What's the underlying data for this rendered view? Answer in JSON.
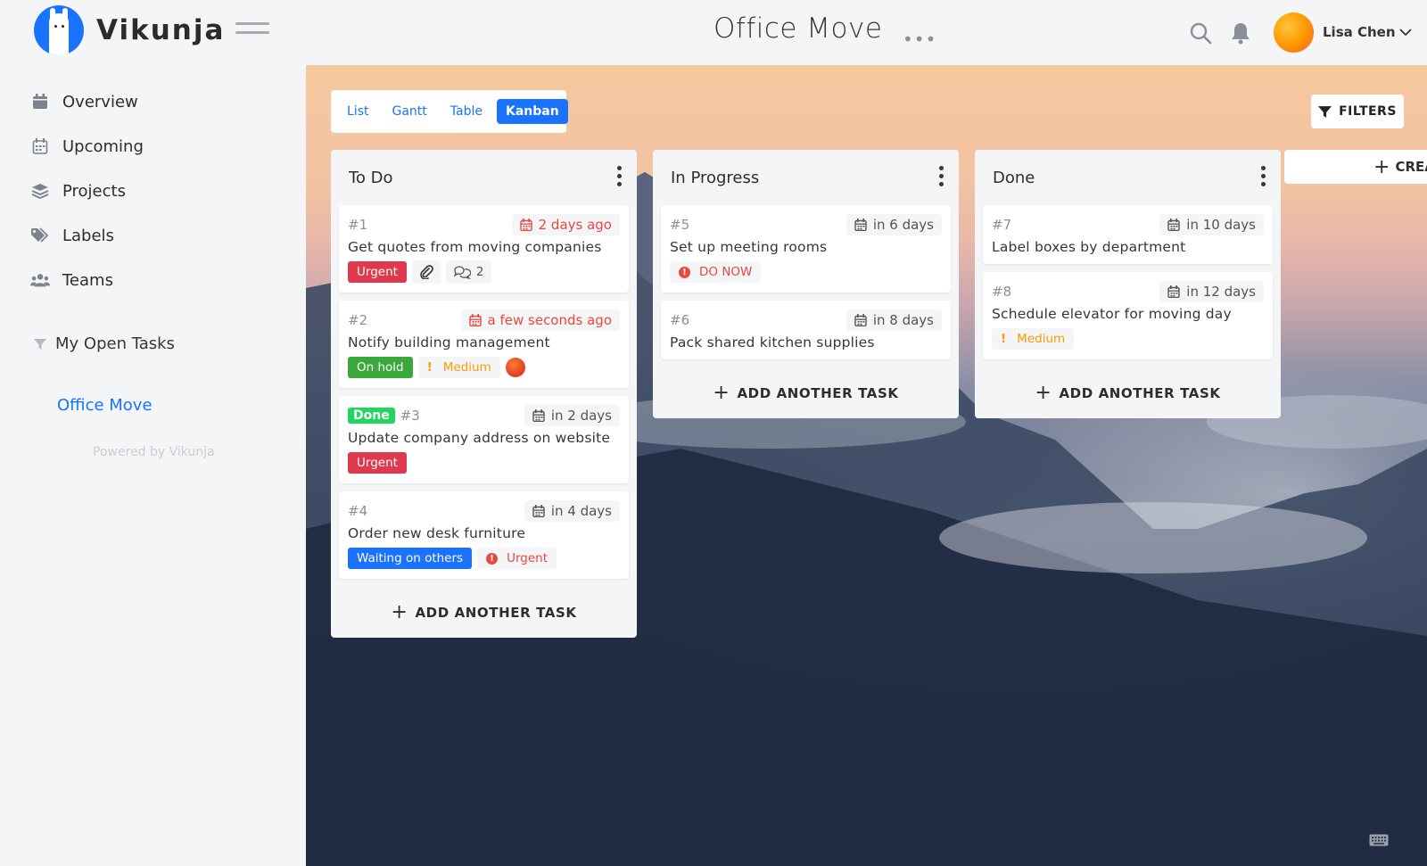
{
  "app": {
    "name": "Vikunja"
  },
  "header": {
    "board_title": "Office Move",
    "more_dots": "•••",
    "user_name": "Lisa Chen"
  },
  "sidebar": {
    "items": [
      {
        "label": "Overview",
        "icon": "calendar-icon"
      },
      {
        "label": "Upcoming",
        "icon": "calendar-grid-icon"
      },
      {
        "label": "Projects",
        "icon": "layers-icon"
      },
      {
        "label": "Labels",
        "icon": "tags-icon"
      },
      {
        "label": "Teams",
        "icon": "users-icon"
      }
    ],
    "saved_filter": "My Open Tasks",
    "project": "Office Move",
    "powered_by": "Powered by Vikunja"
  },
  "views": {
    "tabs": [
      "List",
      "Gantt",
      "Table",
      "Kanban"
    ],
    "active": "Kanban"
  },
  "filters_label": "FILTERS",
  "new_bucket_label": "CREATE A NEW BUCKET",
  "add_task_label": "ADD ANOTHER TASK",
  "colors": {
    "primary": "#1973ff",
    "urgent_label": "#e0384d",
    "on_hold_label": "#3aa83a",
    "waiting_label": "#1973ff",
    "done_badge": "#1fd660",
    "overdue": "#e8483f",
    "medium_priority": "#ff9a00"
  },
  "buckets": [
    {
      "title": "To Do",
      "tasks": [
        {
          "id": "#1",
          "due": "2 days ago",
          "overdue": true,
          "title": "Get quotes from moving companies",
          "labels": [
            {
              "text": "Urgent",
              "color": "#e0384d"
            }
          ],
          "attachment": true,
          "comments": "2"
        },
        {
          "id": "#2",
          "due": "a few seconds ago",
          "overdue": true,
          "title": "Notify building management",
          "labels": [
            {
              "text": "On hold",
              "color": "#3aa83a"
            }
          ],
          "priority": "Medium",
          "assignee": true
        },
        {
          "id": "#3",
          "done": "Done",
          "due": "in 2 days",
          "title": "Update company address on website",
          "labels": [
            {
              "text": "Urgent",
              "color": "#e0384d"
            }
          ]
        },
        {
          "id": "#4",
          "due": "in 4 days",
          "title": "Order new desk furniture",
          "labels": [
            {
              "text": "Waiting on others",
              "color": "#1973ff"
            }
          ],
          "priority_high": "Urgent"
        }
      ]
    },
    {
      "title": "In Progress",
      "tasks": [
        {
          "id": "#5",
          "due": "in 6 days",
          "title": "Set up meeting rooms",
          "priority_high": "DO NOW"
        },
        {
          "id": "#6",
          "due": "in 8 days",
          "title": "Pack shared kitchen supplies"
        }
      ]
    },
    {
      "title": "Done",
      "tasks": [
        {
          "id": "#7",
          "due": "in 10 days",
          "title": "Label boxes by department"
        },
        {
          "id": "#8",
          "due": "in 12 days",
          "title": "Schedule elevator for moving day",
          "priority": "Medium"
        }
      ]
    }
  ]
}
